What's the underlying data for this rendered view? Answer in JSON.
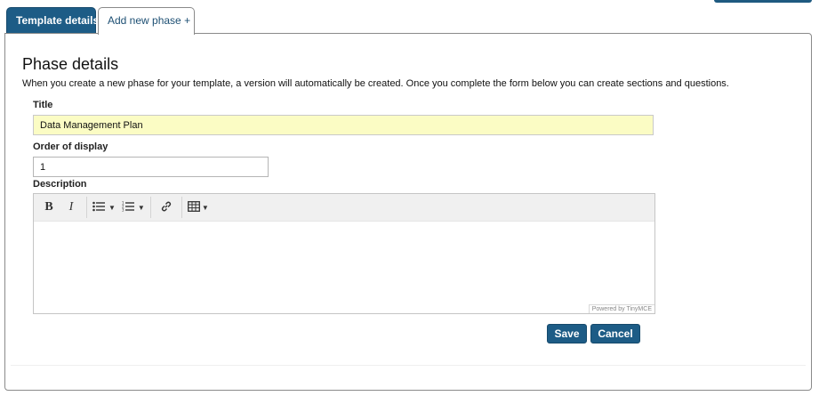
{
  "tabs": [
    {
      "label": "Template details",
      "active": true
    },
    {
      "label": "Add new phase +",
      "active": false
    }
  ],
  "page": {
    "title": "Phase details",
    "intro": "When you create a new phase for your template, a version will automatically be created. Once you complete the form below you can create sections and questions."
  },
  "form": {
    "title_label": "Title",
    "title_value": "Data Management Plan",
    "order_label": "Order of display",
    "order_value": "1",
    "description_label": "Description",
    "description_value": ""
  },
  "editor": {
    "toolbar": [
      {
        "name": "bold-icon",
        "glyph": "B"
      },
      {
        "name": "italic-icon",
        "glyph": "I"
      },
      {
        "name": "bullet-list-icon",
        "glyph": "☰"
      },
      {
        "name": "numbered-list-icon",
        "glyph": "☷"
      },
      {
        "name": "link-icon",
        "glyph": "🔗"
      },
      {
        "name": "table-icon",
        "glyph": "⊞"
      }
    ],
    "powered_by": "Powered by TinyMCE"
  },
  "actions": {
    "save_label": "Save",
    "cancel_label": "Cancel"
  },
  "colors": {
    "brand": "#1d5c86",
    "title_field_bg": "#fbfcc4"
  }
}
